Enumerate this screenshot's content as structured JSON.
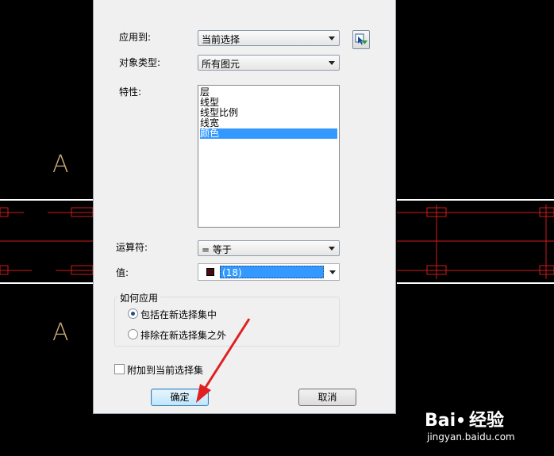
{
  "dialog": {
    "apply_to_label": "应用到:",
    "apply_to_value": "当前选择",
    "object_type_label": "对象类型:",
    "object_type_value": "所有图元",
    "properties_label": "特性:",
    "properties": [
      {
        "label": "层",
        "selected": false
      },
      {
        "label": "线型",
        "selected": false
      },
      {
        "label": "线型比例",
        "selected": false
      },
      {
        "label": "线宽",
        "selected": false
      },
      {
        "label": "颜色",
        "selected": true
      }
    ],
    "operator_label": "运算符:",
    "operator_value": "= 等于",
    "value_label": "值:",
    "value_value": "(18)",
    "value_color": "#4a0b10",
    "how_to_apply_title": "如何应用",
    "radio_include": "包括在新选择集中",
    "radio_exclude": "排除在新选择集之外",
    "radio_selected": "include",
    "append_checkbox": "附加到当前选择集",
    "append_checked": false,
    "ok_button": "确定",
    "cancel_button": "取消"
  },
  "background": {
    "letter_top": "A",
    "letter_bottom": "A"
  },
  "watermark": {
    "brand_prefix": "Bai",
    "brand_suffix": "经验",
    "url": "jingyan.baidu.com"
  },
  "colors": {
    "selection": "#3399ff",
    "cad_red": "#d11a1a",
    "arrow_red": "#e02020"
  }
}
